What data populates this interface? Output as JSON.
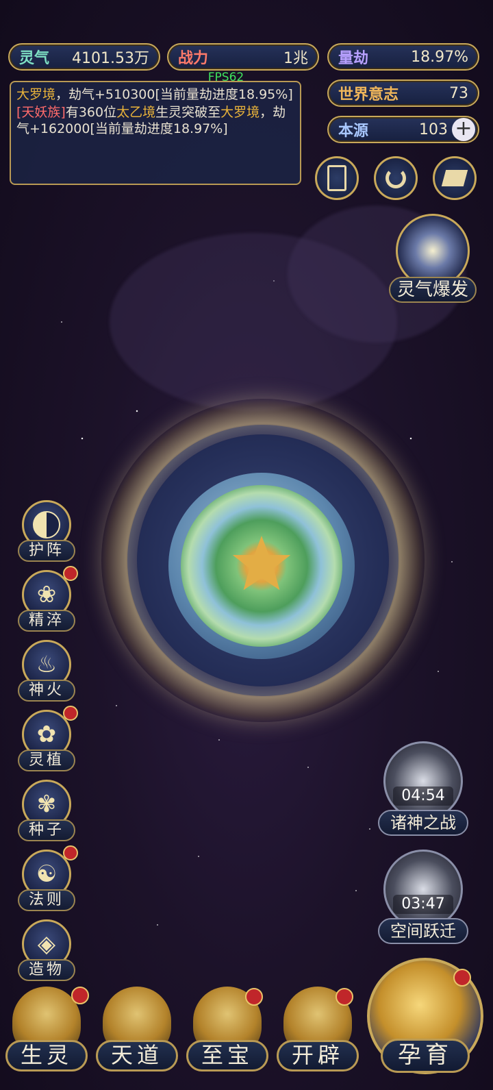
{
  "hud": {
    "lingqi": {
      "label": "灵气",
      "value": "4101.53万"
    },
    "zhanli": {
      "label": "战力",
      "value": "1兆"
    },
    "liangjie": {
      "label": "量劫",
      "value": "18.97%"
    },
    "shijie": {
      "label": "世界意志",
      "value": "73"
    },
    "benyuan": {
      "label": "本源",
      "value": "103"
    }
  },
  "fps": "FPS62",
  "log": {
    "line1_realm": "大罗境",
    "line1_text": "，劫气+510300[当前量劫进度18.95%]",
    "line2_race": "[天妖族]",
    "line2_a": "有360位",
    "line2_realm1": "太乙境",
    "line2_b": "生灵突破至",
    "line2_realm2": "大罗境",
    "line2_c": "，劫气+162000[当前量劫进度18.97%]"
  },
  "side_menu": [
    {
      "label": "护阵",
      "icon": "yin-yang-icon",
      "badge": false
    },
    {
      "label": "精淬",
      "icon": "lotus-flame-icon",
      "badge": true
    },
    {
      "label": "神火",
      "icon": "divine-fire-icon",
      "badge": false
    },
    {
      "label": "灵植",
      "icon": "spirit-plant-icon",
      "badge": true
    },
    {
      "label": "种子",
      "icon": "seed-flower-icon",
      "badge": false
    },
    {
      "label": "法则",
      "icon": "law-beast-icon",
      "badge": true
    },
    {
      "label": "造物",
      "icon": "creation-diamond-icon",
      "badge": false
    }
  ],
  "top_icons": [
    "card-icon",
    "vortex-icon",
    "scroll-icon"
  ],
  "burst": {
    "label": "灵气爆发"
  },
  "events": [
    {
      "label": "诸神之战",
      "timer": "04:54",
      "icon": "sword-icon"
    },
    {
      "label": "空间跃迁",
      "timer": "03:47",
      "icon": "swirl-icon"
    }
  ],
  "bottom_nav": [
    {
      "label": "生灵",
      "badge": true
    },
    {
      "label": "天道",
      "badge": false
    },
    {
      "label": "至宝",
      "badge": true
    },
    {
      "label": "开辟",
      "badge": true
    }
  ],
  "yunyu": {
    "label": "孕育",
    "badge": true
  },
  "colors": {
    "gold": "#c9a95a",
    "highlight": "#e8b23a",
    "badge": "#c0262a"
  }
}
